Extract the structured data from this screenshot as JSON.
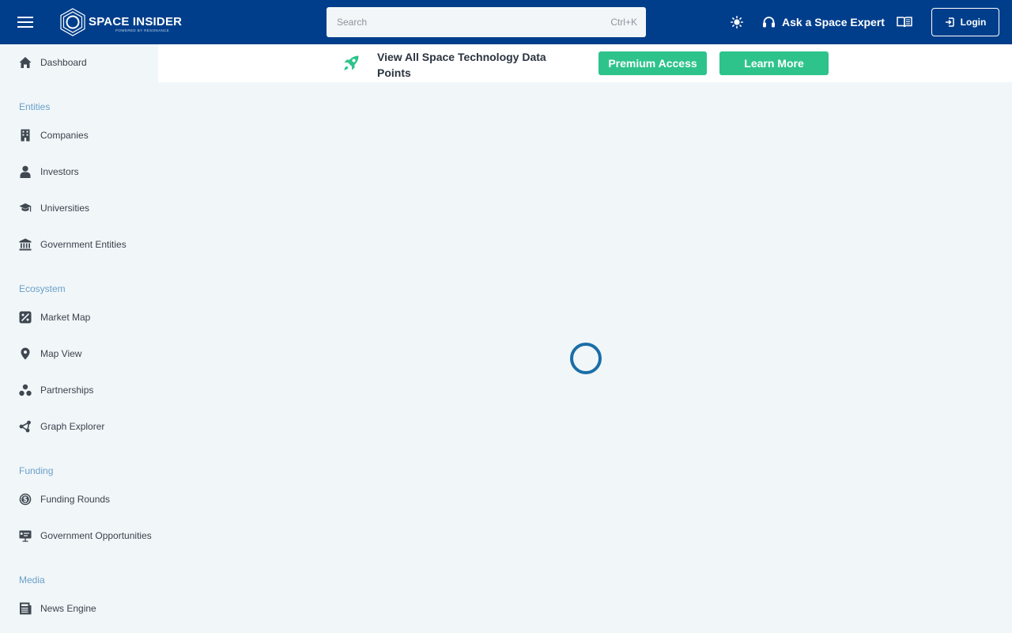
{
  "header": {
    "logo_text": "SPACE INSIDER",
    "logo_sub": "POWERED BY RESONANCE",
    "search_placeholder": "Search",
    "search_shortcut": "Ctrl+K",
    "expert_label": "Ask a Space Expert",
    "login_label": "Login",
    "icons": [
      "menu-icon",
      "sun-icon",
      "headset-icon",
      "book-icon",
      "login-icon"
    ]
  },
  "banner": {
    "title": "View All Space Technology Data Points",
    "premium_label": "Premium Access",
    "learn_label": "Learn More"
  },
  "sidebar": {
    "dashboard": "Dashboard",
    "sections": {
      "entities": "Entities",
      "ecosystem": "Ecosystem",
      "funding": "Funding",
      "media": "Media"
    },
    "items": {
      "companies": "Companies",
      "investors": "Investors",
      "universities": "Universities",
      "government_entities": "Government Entities",
      "market_map": "Market Map",
      "map_view": "Map View",
      "partnerships": "Partnerships",
      "graph_explorer": "Graph Explorer",
      "funding_rounds": "Funding Rounds",
      "government_opportunities": "Government Opportunities",
      "news_engine": "News Engine"
    }
  },
  "colors": {
    "header_bg": "#003e8b",
    "accent_green": "#2ec38b",
    "section_label": "#6aa0c9",
    "spinner": "#1a6ea8",
    "page_bg": "#f1f6f9"
  }
}
